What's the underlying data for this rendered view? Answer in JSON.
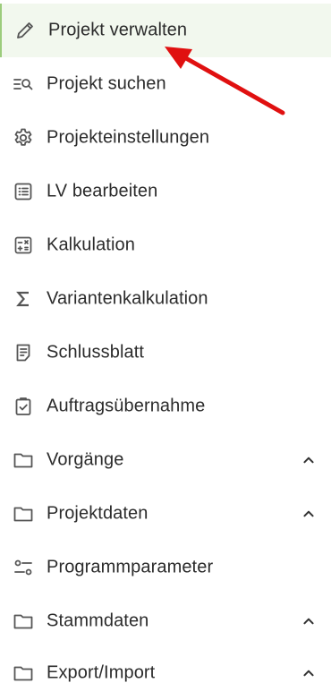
{
  "menu": {
    "items": [
      {
        "label": "Projekt verwalten",
        "icon": "pencil-icon",
        "active": true
      },
      {
        "label": "Projekt suchen",
        "icon": "search-list-icon"
      },
      {
        "label": "Projekteinstellungen",
        "icon": "gear-icon"
      },
      {
        "label": "LV bearbeiten",
        "icon": "list-icon"
      },
      {
        "label": "Kalkulation",
        "icon": "calculator-icon"
      },
      {
        "label": "Variantenkalkulation",
        "icon": "sigma-icon"
      },
      {
        "label": "Schlussblatt",
        "icon": "document-icon"
      },
      {
        "label": "Auftragsübernahme",
        "icon": "clipboard-check-icon"
      },
      {
        "label": "Vorgänge",
        "icon": "folder-icon",
        "expandable": true,
        "chevron": "chevron-up-icon"
      },
      {
        "label": "Projektdaten",
        "icon": "folder-icon",
        "expandable": true,
        "chevron": "chevron-up-icon"
      },
      {
        "label": "Programmparameter",
        "icon": "settings-sliders-icon"
      },
      {
        "label": "Stammdaten",
        "icon": "folder-icon",
        "expandable": true,
        "chevron": "chevron-up-icon"
      },
      {
        "label": "Export/Import",
        "icon": "folder-icon",
        "expandable": true,
        "chevron": "chevron-up-icon"
      }
    ]
  },
  "colors": {
    "active_background": "#f2f8ee",
    "active_border": "#9ccc7c",
    "text": "#2b2b2b",
    "icon": "#555555",
    "annotation_arrow": "#e01010"
  },
  "annotation": {
    "type": "red-arrow",
    "points_to": "Projekt verwalten"
  }
}
